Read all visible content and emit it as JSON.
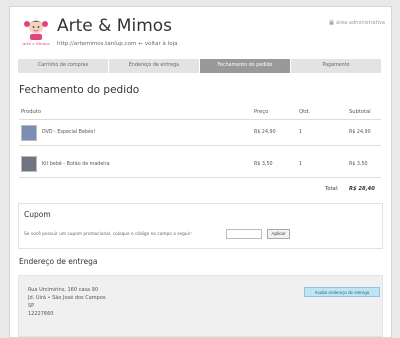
{
  "header": {
    "logo_text": "Arte e Mimos",
    "store_name": "Arte & Mimos",
    "store_url": "http://artemimos.tanlup.com",
    "back_link": "voltar à loja",
    "admin_area": "área administrativa"
  },
  "steps": [
    {
      "label": "Carrinho de compras",
      "active": false
    },
    {
      "label": "Endereço de entrega",
      "active": false
    },
    {
      "label": "Fechamento do pedido",
      "active": true
    },
    {
      "label": "Pagamento",
      "active": false
    }
  ],
  "page_title": "Fechamento do pedido",
  "cart": {
    "headers": {
      "product": "Produto",
      "price": "Preço",
      "qty": "Qtd.",
      "subtotal": "Subtotal"
    },
    "rows": [
      {
        "name": "DVD - Especial Bebês!",
        "price": "R$ 24,90",
        "qty": "1",
        "subtotal": "R$ 24,90"
      },
      {
        "name": "Kit bebê - Botão de madeira",
        "price": "R$ 3,50",
        "qty": "1",
        "subtotal": "R$ 3,50"
      }
    ],
    "total_label": "Total:",
    "total_value": "R$ 28,40"
  },
  "coupon": {
    "title": "Cupom",
    "text": "Se você possuir um cupom promocional, coloque o código no campo a seguir:",
    "input_value": "",
    "button": "Aplicar"
  },
  "address": {
    "title": "Endereço de entrega",
    "lines": [
      "Rua Urcimirins, 160 casa 90",
      "Jd. Uirá • São José dos Campos",
      "SP",
      "12227660"
    ],
    "change_button": "mudar endereço de entrega"
  }
}
